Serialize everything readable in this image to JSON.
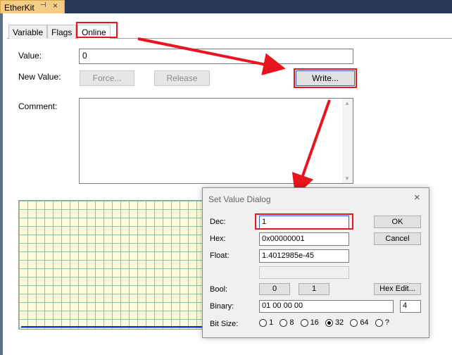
{
  "doc_tab": {
    "title": "EtherKit",
    "pin": "⊣",
    "close": "×"
  },
  "tabs": [
    {
      "label": "Variable"
    },
    {
      "label": "Flags"
    },
    {
      "label": "Online"
    }
  ],
  "online": {
    "value_label": "Value:",
    "value": "0",
    "new_value_label": "New Value:",
    "force_label": "Force...",
    "release_label": "Release",
    "write_label": "Write...",
    "comment_label": "Comment:",
    "comment": ""
  },
  "dialog": {
    "title": "Set Value Dialog",
    "close": "×",
    "dec_label": "Dec:",
    "dec_value": "1",
    "hex_label": "Hex:",
    "hex_value": "0x00000001",
    "float_label": "Float:",
    "float_value": "1.4012985e-45",
    "extra_value": "",
    "bool_label": "Bool:",
    "bool_0": "0",
    "bool_1": "1",
    "binary_label": "Binary:",
    "binary_value": "01 00 00 00",
    "binary_count": "4",
    "bitsize_label": "Bit Size:",
    "bitsizes": [
      {
        "label": "1",
        "checked": false
      },
      {
        "label": "8",
        "checked": false
      },
      {
        "label": "16",
        "checked": false
      },
      {
        "label": "32",
        "checked": true
      },
      {
        "label": "64",
        "checked": false
      },
      {
        "label": "?",
        "checked": false
      }
    ],
    "ok_label": "OK",
    "cancel_label": "Cancel",
    "hexedit_label": "Hex Edit..."
  },
  "colors": {
    "highlight": "#e8141e",
    "plot_line": "#2222dd",
    "grid": "#79c9bb"
  }
}
